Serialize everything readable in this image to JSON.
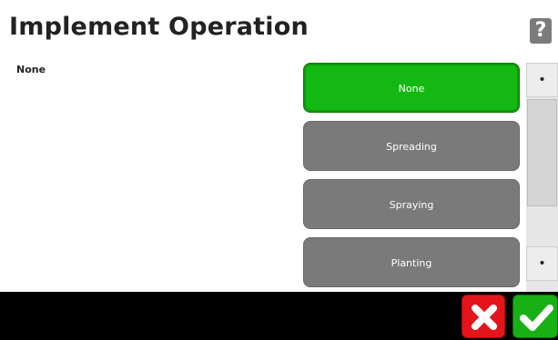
{
  "header": {
    "title": "Implement Operation",
    "help_label": "?"
  },
  "current_selection": "None",
  "options": [
    {
      "label": "None",
      "selected": true
    },
    {
      "label": "Spreading",
      "selected": false
    },
    {
      "label": "Spraying",
      "selected": false
    },
    {
      "label": "Planting",
      "selected": false
    }
  ],
  "scrollbar": {
    "up_label": "•",
    "down_label": "•"
  },
  "footer": {
    "cancel_icon": "close-icon",
    "confirm_icon": "check-icon"
  },
  "colors": {
    "selected": "#13b812",
    "option": "#7a7a7a",
    "cancel": "#e4141b",
    "confirm": "#18b014"
  }
}
